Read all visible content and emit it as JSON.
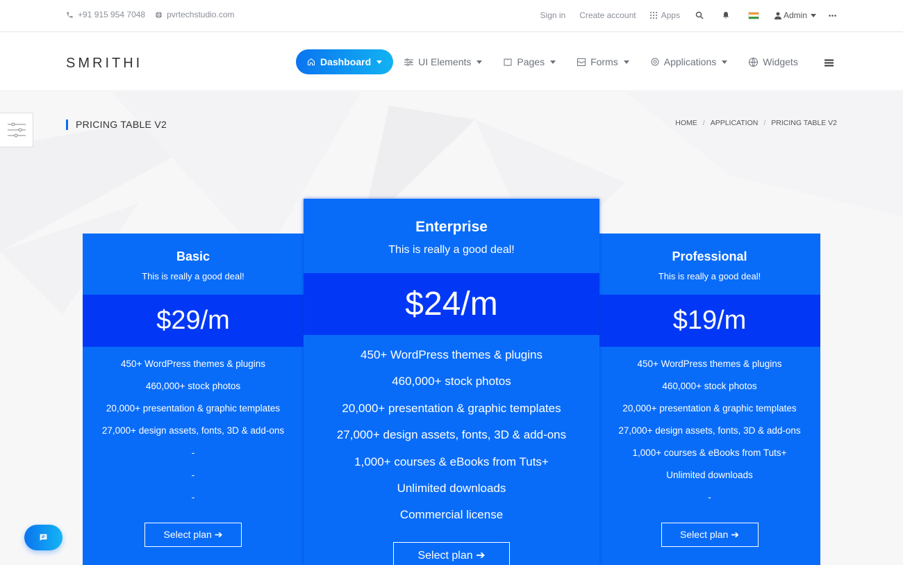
{
  "topbar": {
    "phone": "+91 915 954 7048",
    "website": "pvrtechstudio.com",
    "sign_in": "Sign in",
    "create_account": "Create account",
    "apps": "Apps",
    "user": "Admin"
  },
  "brand": {
    "logo": "SMRITHI"
  },
  "nav": {
    "items": [
      {
        "label": "Dashboard",
        "icon": "home-icon",
        "active": true
      },
      {
        "label": "UI Elements",
        "icon": "sliders-icon"
      },
      {
        "label": "Pages",
        "icon": "book-icon"
      },
      {
        "label": "Forms",
        "icon": "inbox-icon"
      },
      {
        "label": "Applications",
        "icon": "settings-icon"
      },
      {
        "label": "Widgets",
        "icon": "globe-icon"
      }
    ]
  },
  "page": {
    "title": "PRICING TABLE V2",
    "breadcrumb": [
      "HOME",
      "APPLICATION",
      "PRICING TABLE V2"
    ]
  },
  "plans": [
    {
      "name": "Basic",
      "tagline": "This is really a good deal!",
      "price": "$29/m",
      "features": [
        "450+ WordPress themes & plugins",
        "460,000+ stock photos",
        "20,000+ presentation & graphic templates",
        "27,000+ design assets, fonts, 3D & add-ons",
        "-",
        "-",
        "-"
      ],
      "button": "Select plan ➔"
    },
    {
      "name": "Enterprise",
      "tagline": "This is really a good deal!",
      "price": "$24/m",
      "features": [
        "450+ WordPress themes & plugins",
        "460,000+ stock photos",
        "20,000+ presentation & graphic templates",
        "27,000+ design assets, fonts, 3D & add-ons",
        "1,000+ courses & eBooks from Tuts+",
        "Unlimited downloads",
        "Commercial license"
      ],
      "button": "Select plan ➔"
    },
    {
      "name": "Professional",
      "tagline": "This is really a good deal!",
      "price": "$19/m",
      "features": [
        "450+ WordPress themes & plugins",
        "460,000+ stock photos",
        "20,000+ presentation & graphic templates",
        "27,000+ design assets, fonts, 3D & add-ons",
        "1,000+ courses & eBooks from Tuts+",
        "Unlimited downloads",
        "-"
      ],
      "button": "Select plan ➔"
    }
  ],
  "colors": {
    "primary": "#096cf9",
    "price_band": "#0238f5",
    "accent_gradient_start": "#0a74f0",
    "accent_gradient_end": "#12b3f2"
  }
}
